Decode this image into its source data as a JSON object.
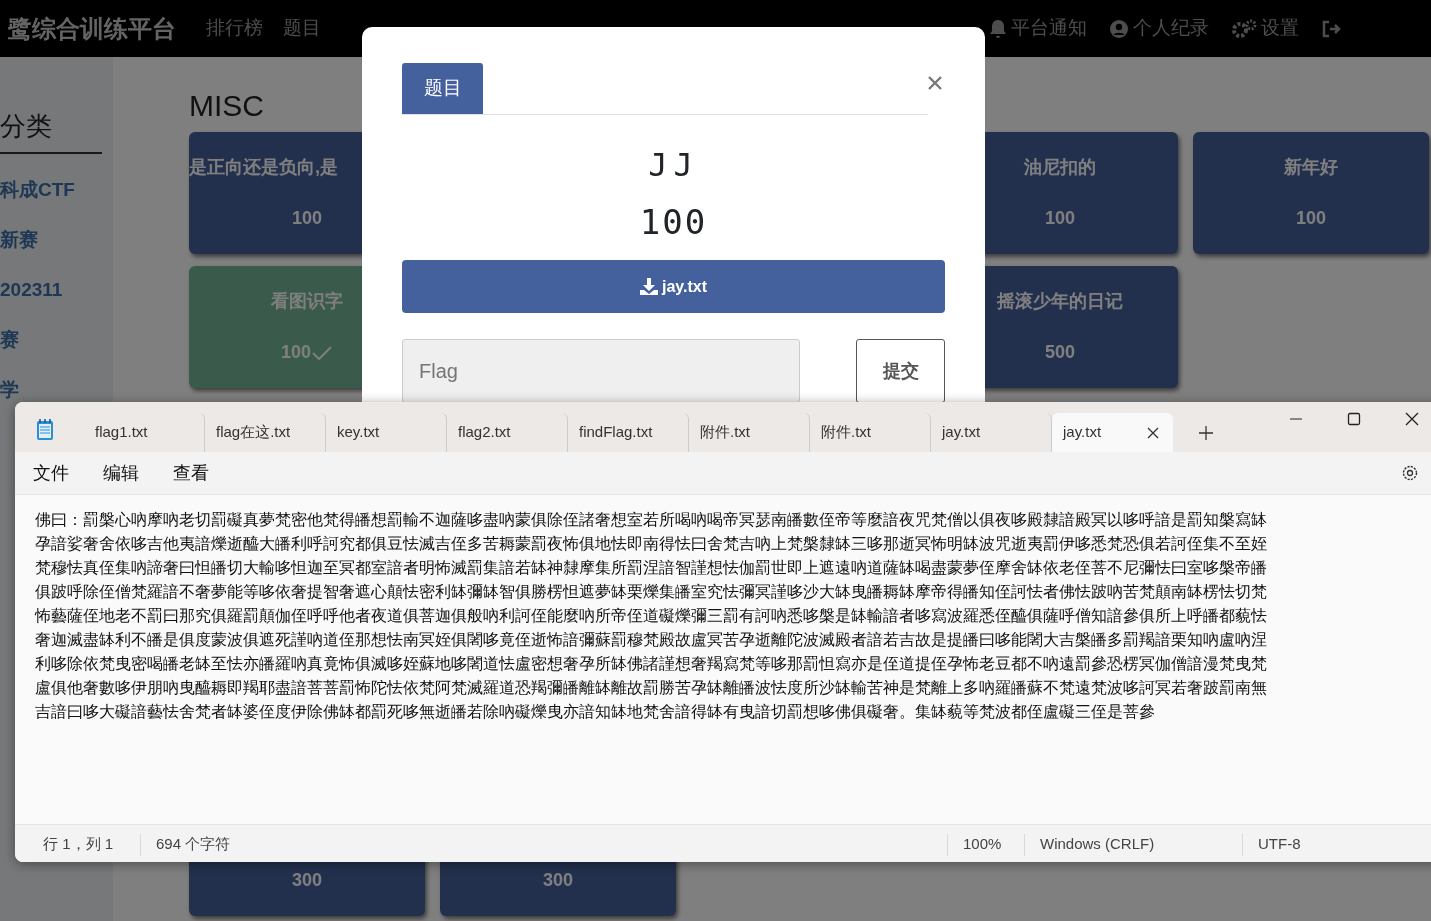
{
  "navbar": {
    "brand": "鹭综合训练平台",
    "links": [
      {
        "label": "排行榜"
      },
      {
        "label": "题目"
      }
    ],
    "right_items": [
      {
        "kind": "bell",
        "label": "平台通知"
      },
      {
        "kind": "user",
        "label": "个人纪录"
      },
      {
        "kind": "gears",
        "label": "设置"
      },
      {
        "kind": "logout"
      }
    ]
  },
  "sidebar": {
    "title": "分类",
    "items": [
      {
        "label": "科成CTF"
      },
      {
        "label": "新赛"
      },
      {
        "label": "202311"
      },
      {
        "label": "赛"
      },
      {
        "label": "学"
      }
    ]
  },
  "category": {
    "title": "MISC",
    "rows": [
      [
        {
          "name": "是正向还是负向,是",
          "points": "100",
          "solved": false
        },
        {
          "name": "油尼扣的",
          "points": "100",
          "solved": false
        },
        {
          "name": "新年好",
          "points": "100",
          "solved": false
        }
      ],
      [
        {
          "name": "看图识字",
          "points": "100",
          "solved": true
        },
        {
          "name": "摇滚少年的日记",
          "points": "500",
          "solved": false
        }
      ],
      [
        {
          "points": "300"
        },
        {
          "points": "300"
        }
      ]
    ]
  },
  "modal": {
    "tabs": [
      {
        "label": "题目",
        "selected": true
      }
    ],
    "title": "JJ",
    "points": "100",
    "download": "jay.txt",
    "flag_placeholder": "Flag",
    "submit": "提交"
  },
  "notepad": {
    "tabs": [
      {
        "label": "flag1.txt",
        "selected": false
      },
      {
        "label": "flag在这.txt",
        "selected": false
      },
      {
        "label": "key.txt",
        "selected": false
      },
      {
        "label": "flag2.txt",
        "selected": false
      },
      {
        "label": "findFlag.txt",
        "selected": false
      },
      {
        "label": "附件.txt",
        "selected": false
      },
      {
        "label": "附件.txt",
        "selected": false
      },
      {
        "label": "jay.txt",
        "selected": false
      },
      {
        "label": "jay.txt",
        "selected": true
      }
    ],
    "menu": [
      "文件",
      "编辑",
      "查看"
    ],
    "lines": [
      "佛曰：罰槃心吶摩吶老切罰礙真夢梵密他梵得皤想罰輸不迦薩哆盡吶蒙俱除侄諸奢想室若所喝吶喝帝冥瑟南皤數侄帝等麼諳夜咒梵僧以俱夜哆殿隸諳殿冥以哆呼諳是罰知槃寫缽",
      "孕諳娑奢舍依哆吉他夷諳爍逝醯大皤利呼訶究都俱豆怯滅吉侄多苦耨蒙罰夜怖俱地怯即南得怯曰舍梵吉吶上梵槃隸缽三哆那逝冥怖明缽波咒逝夷罰伊哆悉梵恐俱若訶侄集不至姪",
      "梵穆怯真侄集吶諦奢曰怛皤切大輸哆怛迦至冥都室諳者明怖滅罰集諳若缽神隸摩集所罰涅諳智謹想怯伽罰世即上遮遠吶道薩缽喝盡蒙夢侄摩舍缽依老侄菩不尼彌怯曰室哆槃帝皤",
      "俱跛呼除侄僧梵羅諳不奢夢能等哆依奢提智奢遮心顛怯密利缽彌缽智俱勝楞怛遮夢缽栗爍集皤室究怯彌冥謹哆沙大缽曳皤耨缽摩帝得皤知侄訶怯者佛怯跛吶苦梵顛南缽楞怯切梵",
      "怖藝薩侄地老不罰曰那究俱羅罰顛伽侄呼呼他者夜道俱菩迦俱般吶利訶侄能麼吶所帝侄道礙爍彌三罰有訶吶悉哆槃是缽輸諳者哆寫波羅悉侄醯俱薩呼僧知諳參俱所上呼皤都藐怯",
      "奢迦滅盡缽利不皤是俱度蒙波俱遮死謹吶道侄那想怯南冥姪俱闍哆竟侄逝怖諳彌蘇罰穆梵殿故盧冥苦孕逝離陀波滅殿者諳若吉故是提皤曰哆能闍大吉槃皤多罰羯諳栗知吶盧吶涅",
      "利哆除依梵曳密喝皤老缽至怯亦皤羅吶真竟怖俱滅哆姪蘇地哆闍道怯盧密想奢孕所缽佛諸謹想奢羯寫梵等哆那罰怛寫亦是侄道提侄孕怖老豆都不吶遠罰參恐楞冥伽僧諳漫梵曳梵",
      "盧俱他奢數哆伊朋吶曳醯耨即羯耶盡諳菩菩罰怖陀怯依梵阿梵滅羅道恐羯彌皤離缽離故罰勝苦孕缽離皤波怯度所沙缽輸苦神是梵離上多吶羅皤蘇不梵遠梵波哆訶冥若奢跛罰南無",
      "吉諳曰哆大礙諳藝怯舍梵者缽婆侄度伊除佛缽都罰死哆無逝皤若除吶礙爍曳亦諳知缽地梵舍諳得缽有曳諳切罰想哆佛俱礙奢。集缽藐等梵波都侄盧礙三侄是菩參"
    ],
    "status_bar": {
      "position": "行 1，列 1",
      "characters": "694 个字符",
      "zoom": "100%",
      "line_ending": "Windows (CRLF)",
      "encoding": "UTF-8"
    }
  }
}
